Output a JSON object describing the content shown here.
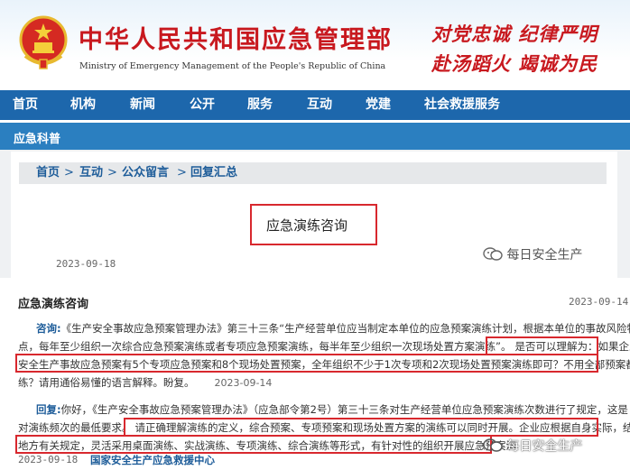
{
  "header": {
    "title": "中华人民共和国应急管理部",
    "subtitle": "Ministry of Emergency Management of the People's Republic of China",
    "slogan_line1": "对党忠诚  纪律严明",
    "slogan_line2": "赴汤蹈火  竭诚为民"
  },
  "nav": {
    "items": [
      "首页",
      "机构",
      "新闻",
      "公开",
      "服务",
      "互动",
      "党建",
      "社会救援服务"
    ]
  },
  "section": {
    "title": "应急科普"
  },
  "breadcrumb": {
    "items": [
      "首页",
      "互动",
      "公众留言",
      "回复汇总"
    ],
    "separator": ">"
  },
  "article_header": {
    "title": "应急演练咨询",
    "date": "2023-09-18",
    "watermark": "每日安全生产"
  },
  "detail": {
    "title": "应急演练咨询",
    "date": "2023-09-14",
    "question": {
      "label": "咨询:",
      "line1": "《生产安全事故应急预案管理办法》第三十三条“生产经营单位应当制定本单位的应急预案演练计划，根据本单位的事故风险特",
      "line2a": "点，每年至少组织一次综合应急预案演练或者专项应急预案演练，每半年至少组织一次现场处置方案演练”。",
      "line2b": "是否可以理解为：如果企业",
      "line3": "安全生产事故应急预案有5个专项应急预案和8个现场处置预案，全年组织不少于1次专项和2次现场处置预案演练即可？不用全部预案都演",
      "line4a": "练？请用通俗易懂的语言解释。盼复。",
      "line4b": "2023-09-14"
    },
    "reply": {
      "label": "回复:",
      "line1": "你好，《生产安全事故应急预案管理办法》（应急部令第2号）第三十三条对生产经营单位应急预案演练次数进行了规定，这是",
      "line2a": "对演练频次的最低要求。",
      "line2b": "请正确理解演练的定义，综合预案、专项预案和现场处置方案的演练可以同时开展。企业应根据自身实际，结合",
      "line3": "地方有关规定，灵活采用桌面演练、实战演练、专项演练、综合演练等形式，有针对性的组织开展应急预案演",
      "date": "2023-09-18",
      "org": "国家安全生产应急救援中心",
      "watermark": "每日安全生产"
    }
  },
  "colors": {
    "brand_red": "#c8191f",
    "nav_blue": "#1d67ac",
    "highlight_red": "#d8282e",
    "link_blue": "#1d5c99"
  }
}
